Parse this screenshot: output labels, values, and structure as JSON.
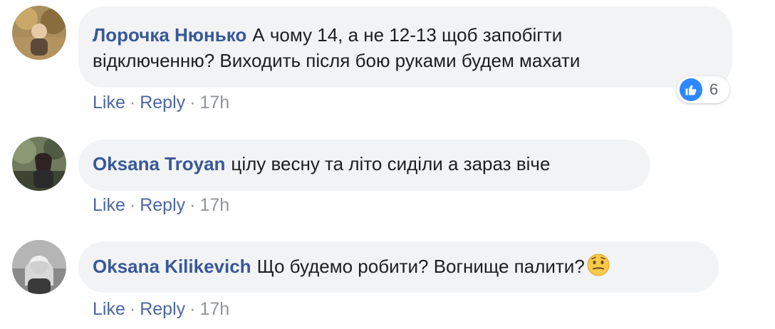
{
  "comments": [
    {
      "author": "Лорочка Нюнько",
      "text_line1": "А чому 14, а не 12-13 щоб запобігти",
      "text_line2": "відключенню? Виходить після бою руками будем махати",
      "actions": {
        "like": "Like",
        "sep": "·",
        "reply": "Reply",
        "time": "17h"
      },
      "reactions": {
        "icon": "like-icon",
        "count": "6"
      }
    },
    {
      "author": "Oksana Troyan",
      "text": "цілу весну та літо сиділи а зараз віче",
      "actions": {
        "like": "Like",
        "sep": "·",
        "reply": "Reply",
        "time": "17h"
      }
    },
    {
      "author": "Oksana Kilikevich",
      "text": "Що будемо робити? Вогнище палити?",
      "emoji": "thinking-face-icon",
      "actions": {
        "like": "Like",
        "sep": "·",
        "reply": "Reply",
        "time": "17h"
      }
    }
  ],
  "colors": {
    "author": "#385898",
    "bubble": "#f2f3f5",
    "action_link": "#4b67a1",
    "meta": "#90949c",
    "like_blue": "#2d88ff"
  }
}
